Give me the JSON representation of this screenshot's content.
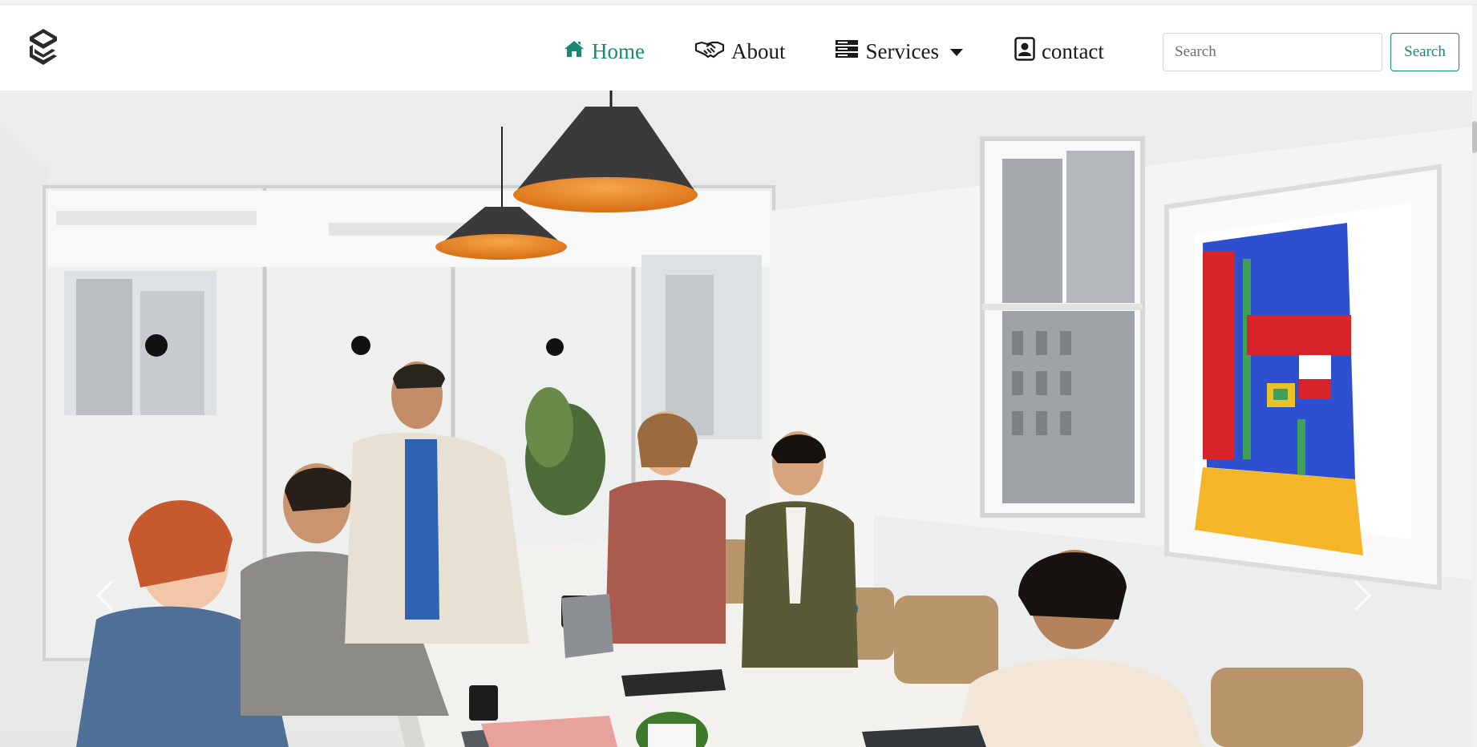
{
  "nav": {
    "brand_icon": "brand-logo-icon",
    "items": [
      {
        "label": "Home",
        "icon": "home-icon",
        "active": true
      },
      {
        "label": "About",
        "icon": "handshake-icon"
      },
      {
        "label": "Services",
        "icon": "server-icon"
      },
      {
        "label": "contact",
        "icon": "contact-card-icon"
      }
    ]
  },
  "search": {
    "placeholder": "Search",
    "button_label": "Search"
  },
  "carousel": {
    "image": "office-meeting-photo",
    "prev_icon": "chevron-left-icon",
    "next_icon": "chevron-right-icon"
  },
  "colors": {
    "accent": "#168a6f",
    "text": "#1a1a1a"
  }
}
